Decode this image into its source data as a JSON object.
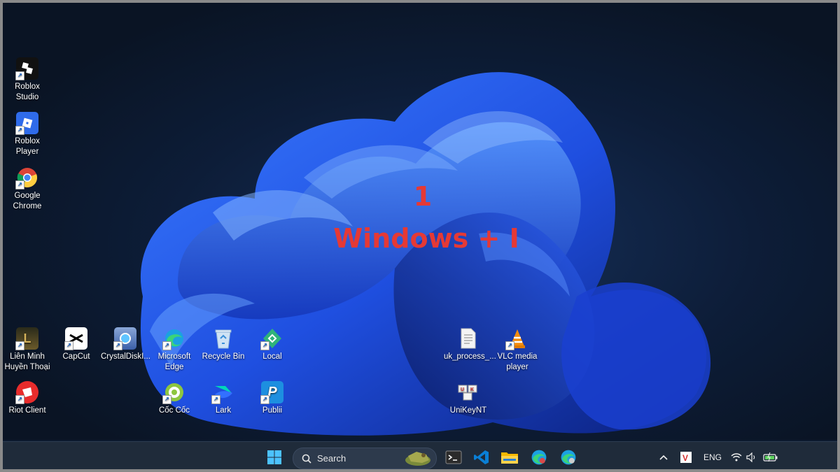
{
  "overlay": {
    "step_number": "1",
    "shortcut": "Windows + I"
  },
  "desktop_icons": {
    "roblox_studio": "Roblox\nStudio",
    "roblox_player": "Roblox Player",
    "google_chrome": "Google\nChrome",
    "lien_minh": "Liên Minh\nHuyền Thoại",
    "capcut": "CapCut",
    "crystaldisk": "CrystalDiskI...",
    "microsoft_edge": "Microsoft\nEdge",
    "recycle_bin": "Recycle Bin",
    "local": "Local",
    "uk_process": "uk_process_...",
    "vlc": "VLC media\nplayer",
    "riot_client": "Riot Client",
    "coc_coc": "Cốc Cốc",
    "lark": "Lark",
    "publii": "Publii",
    "unikey": "UniKeyNT"
  },
  "taskbar": {
    "search_label": "Search",
    "language": "ENG"
  },
  "colors": {
    "overlay_text": "#e53935",
    "taskbar_bg": "#1f2b3a",
    "accent": "#2b6fff"
  },
  "icons": [
    "windows-start-icon",
    "search-icon",
    "terminal-icon",
    "vscode-icon",
    "file-explorer-icon",
    "edge-icon",
    "edge-profile-icon",
    "chevron-up-icon",
    "vietkey-icon",
    "wifi-icon",
    "volume-icon",
    "battery-icon"
  ]
}
